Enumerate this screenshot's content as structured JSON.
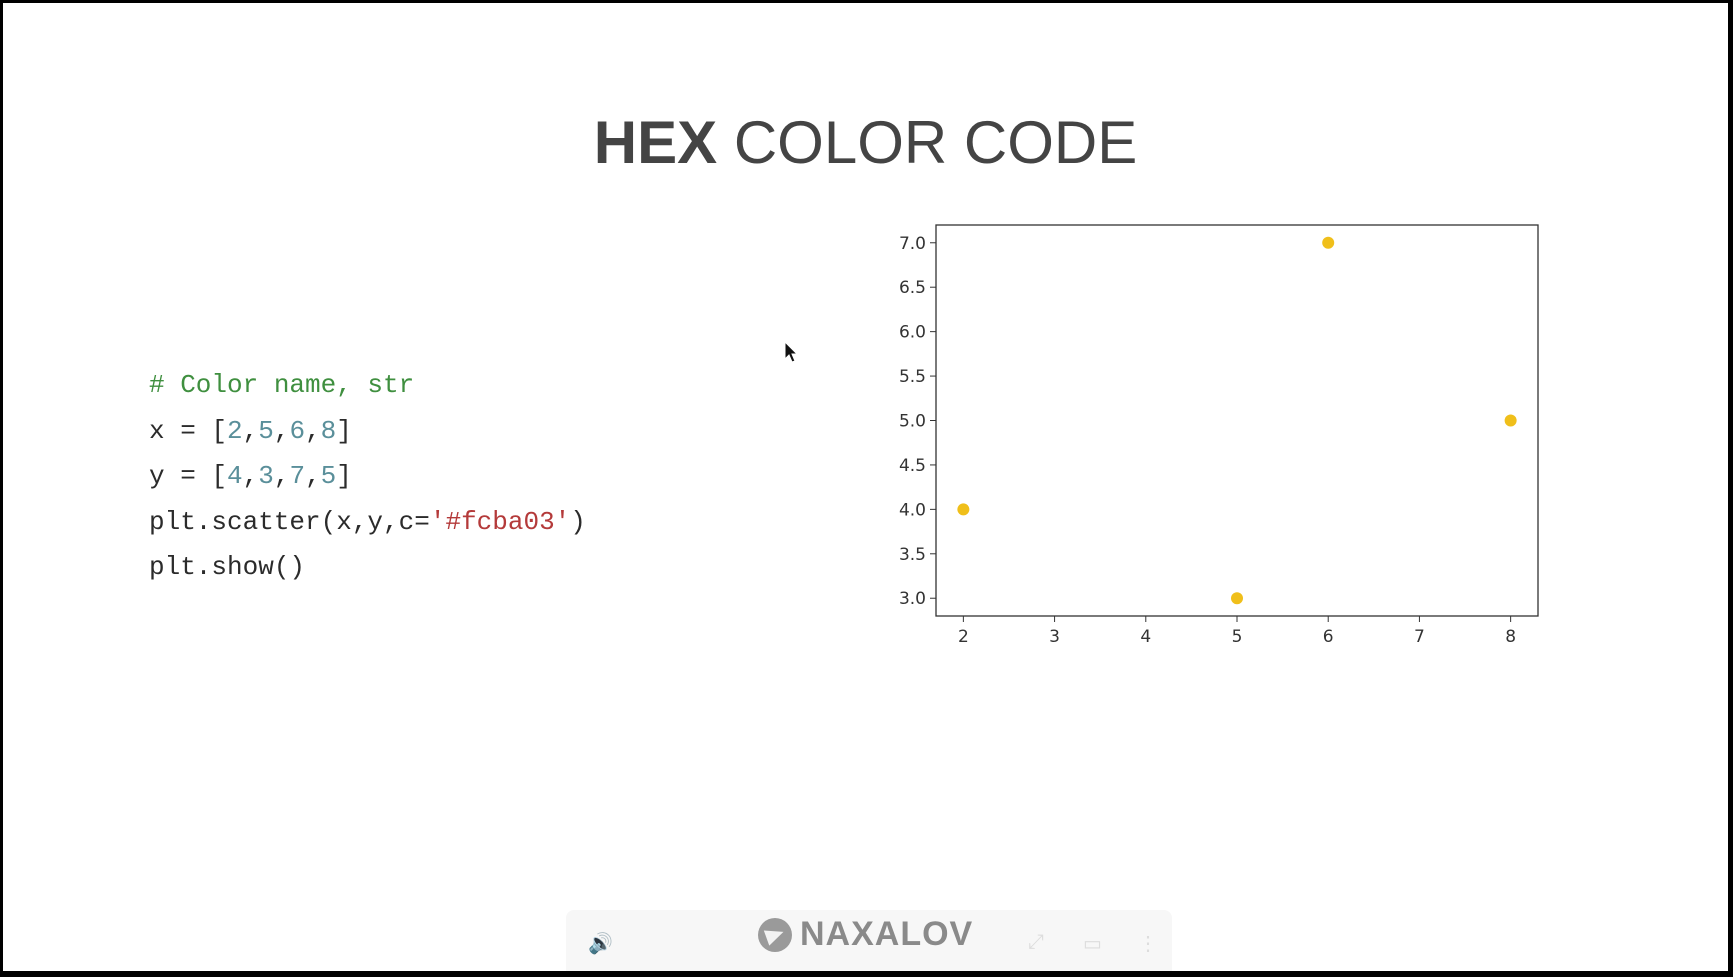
{
  "slide": {
    "title_bold": "HEX",
    "title_rest": "COLOR CODE"
  },
  "code": {
    "comment": "# Color name, str",
    "x_prefix": "x = [",
    "x_values": [
      "2",
      "5",
      "6",
      "8"
    ],
    "y_prefix": "y = [",
    "y_values": [
      "4",
      "3",
      "7",
      "5"
    ],
    "scatter_prefix": "plt.scatter(x,y,c=",
    "scatter_str": "'#fcba03'",
    "scatter_suffix": ")",
    "show": "plt.show()"
  },
  "watermark": {
    "text": "NAXALOV"
  },
  "colors": {
    "marker": "#f0bf1a",
    "title": "#444444",
    "comment": "#3f8f3f",
    "number": "#5a8f9a",
    "string": "#b43a3a"
  },
  "chart_data": {
    "type": "scatter",
    "x": [
      2,
      5,
      6,
      8
    ],
    "y": [
      4,
      3,
      7,
      5
    ],
    "marker_color": "#fcba03",
    "xlim": [
      1.7,
      8.3
    ],
    "ylim": [
      2.8,
      7.2
    ],
    "xticks": [
      "2",
      "3",
      "4",
      "5",
      "6",
      "7",
      "8"
    ],
    "yticks": [
      "3.0",
      "3.5",
      "4.0",
      "4.5",
      "5.0",
      "5.5",
      "6.0",
      "6.5",
      "7.0"
    ],
    "grid": false,
    "title": "",
    "xlabel": "",
    "ylabel": ""
  }
}
